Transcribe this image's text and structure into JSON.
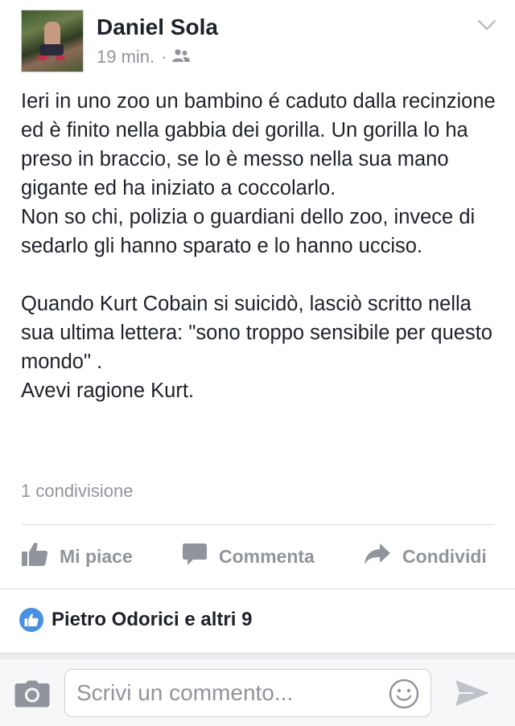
{
  "post": {
    "author": "Daniel Sola",
    "time": "19 min.",
    "separator": "·",
    "audience_icon": "friends-icon",
    "text": "Ieri in uno zoo un bambino é caduto dalla recinzione ed è finito nella gabbia dei gorilla. Un gorilla lo ha preso in braccio, se lo è messo nella sua mano gigante ed ha iniziato a coccolarlo.\nNon so chi, polizia o guardiani dello zoo, invece di sedarlo gli hanno sparato e lo hanno ucciso.\n\nQuando Kurt Cobain si suicidò, lasciò scritto nella sua ultima lettera: \"sono troppo sensibile per questo mondo\" .\nAvevi ragione Kurt.",
    "shares": "1 condivisione"
  },
  "actions": {
    "like_label": "Mi piace",
    "comment_label": "Commenta",
    "share_label": "Condividi"
  },
  "reactions": {
    "summary": "Pietro Odorici e altri 9"
  },
  "composer": {
    "placeholder": "Scrivi un commento..."
  },
  "colors": {
    "text": "#1d2129",
    "muted": "#90949c",
    "like_blue": "#4a90e2",
    "divider": "#dadde1"
  }
}
